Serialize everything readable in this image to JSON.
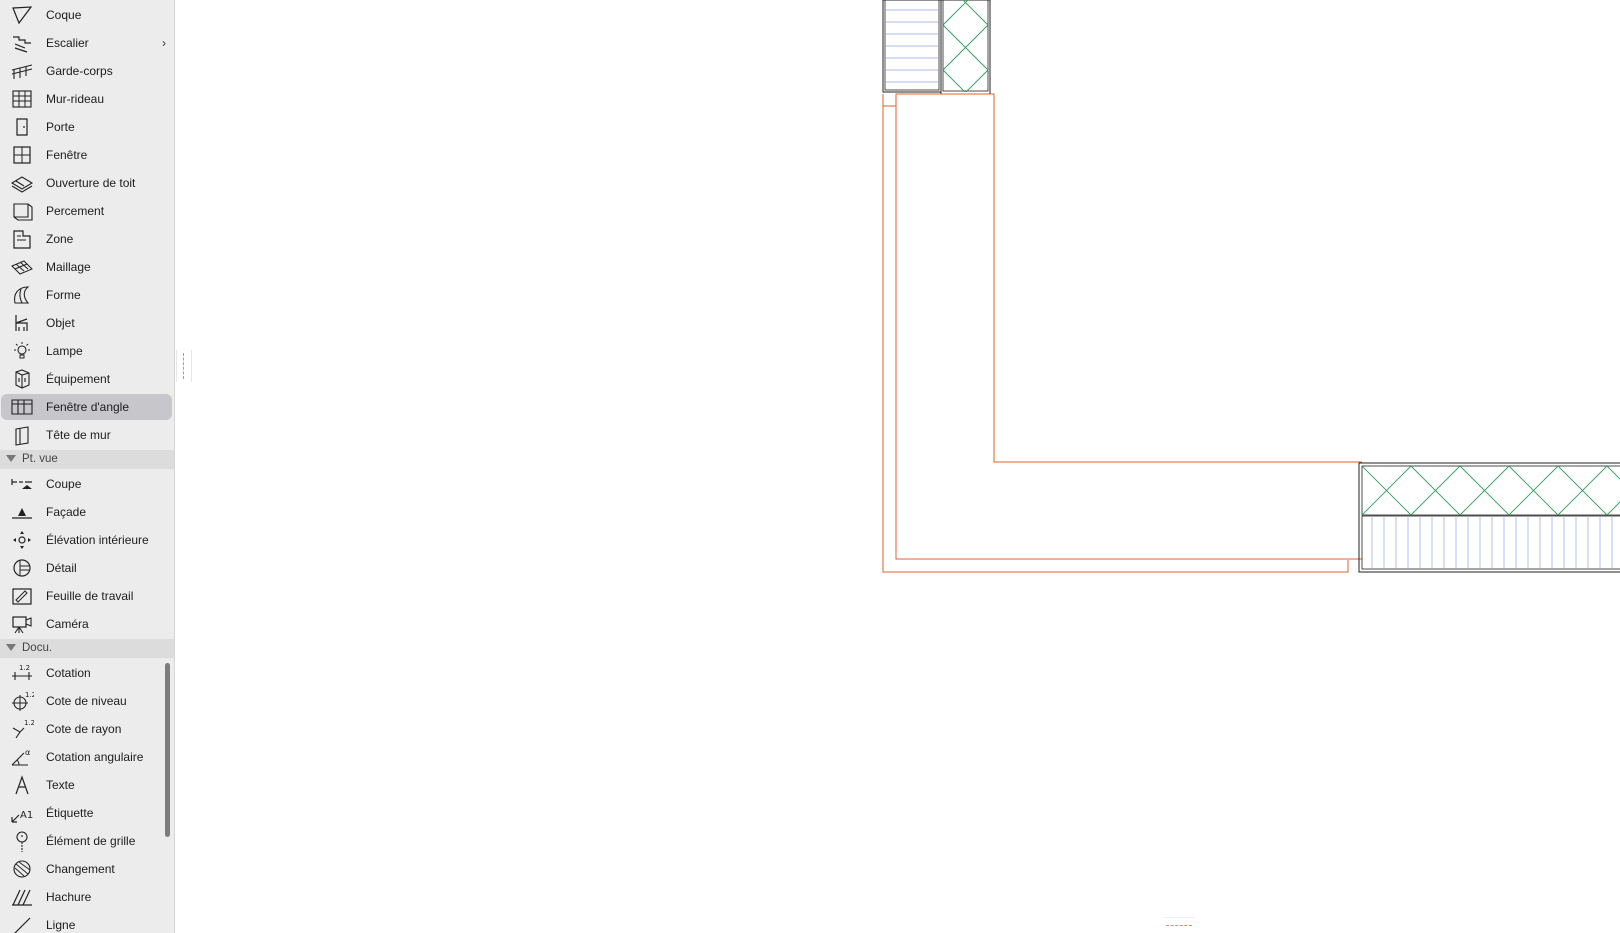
{
  "toolbox": {
    "design_tools": [
      {
        "label": "Coque",
        "icon": "shell-icon"
      },
      {
        "label": "Escalier",
        "icon": "stair-icon",
        "submenu": true
      },
      {
        "label": "Garde-corps",
        "icon": "railing-icon"
      },
      {
        "label": "Mur-rideau",
        "icon": "curtain-wall-icon"
      },
      {
        "label": "Porte",
        "icon": "door-icon"
      },
      {
        "label": "Fenêtre",
        "icon": "window-icon"
      },
      {
        "label": "Ouverture de toit",
        "icon": "skylight-icon"
      },
      {
        "label": "Percement",
        "icon": "opening-icon"
      },
      {
        "label": "Zone",
        "icon": "zone-icon"
      },
      {
        "label": "Maillage",
        "icon": "mesh-icon"
      },
      {
        "label": "Forme",
        "icon": "morph-icon"
      },
      {
        "label": "Objet",
        "icon": "object-chair-icon"
      },
      {
        "label": "Lampe",
        "icon": "lamp-icon"
      },
      {
        "label": "Équipement",
        "icon": "equipment-icon"
      },
      {
        "label": "Fenêtre d'angle",
        "icon": "corner-window-icon",
        "selected": true
      },
      {
        "label": "Tête de mur",
        "icon": "wall-end-icon"
      }
    ],
    "sections": {
      "viewpoint": {
        "label": "Pt. vue"
      },
      "document": {
        "label": "Docu."
      }
    },
    "viewpoint_tools": [
      {
        "label": "Coupe",
        "icon": "section-icon"
      },
      {
        "label": "Façade",
        "icon": "elevation-icon"
      },
      {
        "label": "Élévation intérieure",
        "icon": "interior-elevation-icon"
      },
      {
        "label": "Détail",
        "icon": "detail-icon"
      },
      {
        "label": "Feuille de travail",
        "icon": "worksheet-icon"
      },
      {
        "label": "Caméra",
        "icon": "camera-icon"
      }
    ],
    "document_tools": [
      {
        "label": "Cotation",
        "icon": "dimension-icon"
      },
      {
        "label": "Cote de niveau",
        "icon": "level-dimension-icon"
      },
      {
        "label": "Cote de rayon",
        "icon": "radial-dimension-icon"
      },
      {
        "label": "Cotation angulaire",
        "icon": "angle-dimension-icon"
      },
      {
        "label": "Texte",
        "icon": "text-icon"
      },
      {
        "label": "Étiquette",
        "icon": "label-icon"
      },
      {
        "label": "Élément de grille",
        "icon": "grid-element-icon"
      },
      {
        "label": "Changement",
        "icon": "change-icon"
      },
      {
        "label": "Hachure",
        "icon": "fill-hatch-icon"
      },
      {
        "label": "Ligne",
        "icon": "line-icon"
      }
    ]
  },
  "colors": {
    "sidebar_bg": "#ececec",
    "section_bg": "#dcdcdc",
    "selection_bg": "#c6c6cb",
    "wall_outline": "#e2622c",
    "insulation_hatch": "#2e9c5c",
    "stud_hatch": "#8fa5dd",
    "structure_line": "#222222"
  }
}
